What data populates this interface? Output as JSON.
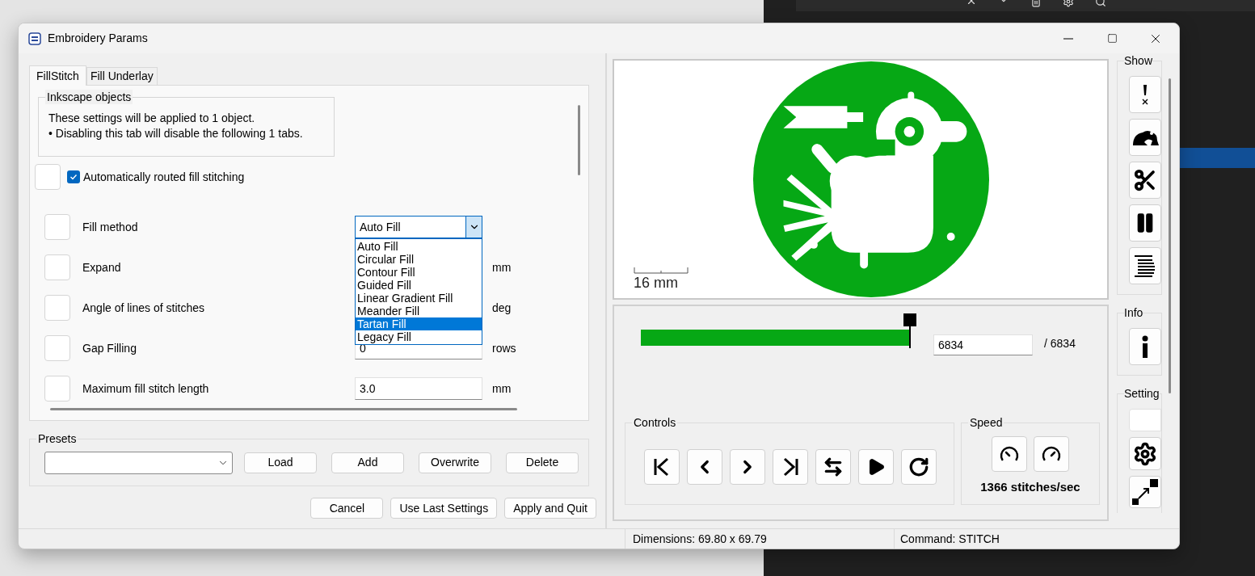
{
  "window": {
    "title": "Embroidery Params"
  },
  "tabs": [
    {
      "label": "FillStitch",
      "selected": true
    },
    {
      "label": "Fill Underlay",
      "selected": false
    }
  ],
  "inkscape_objects": {
    "title": "Inkscape objects",
    "lines": [
      "These settings will be applied to 1 object.",
      "• Disabling this tab will disable the following 1 tabs."
    ]
  },
  "auto_routed": {
    "label": "Automatically routed fill stitching",
    "checked": true
  },
  "params": [
    {
      "label": "Fill method",
      "kind": "dropdown",
      "value": "Auto Fill"
    },
    {
      "label": "Expand",
      "kind": "number",
      "unit": "mm"
    },
    {
      "label": "Angle of lines of stitches",
      "kind": "number",
      "unit": "deg"
    },
    {
      "label": "Gap Filling",
      "kind": "number",
      "value": "0",
      "unit": "rows"
    },
    {
      "label": "Maximum fill stitch length",
      "kind": "number",
      "value": "3.0",
      "unit": "mm"
    }
  ],
  "fill_method_menu": [
    {
      "label": "Auto Fill",
      "selected": false
    },
    {
      "label": "Circular Fill",
      "selected": false
    },
    {
      "label": "Contour Fill",
      "selected": false
    },
    {
      "label": "Guided Fill",
      "selected": false
    },
    {
      "label": "Linear Gradient Fill",
      "selected": false
    },
    {
      "label": "Meander Fill",
      "selected": false
    },
    {
      "label": "Tartan Fill",
      "selected": true
    },
    {
      "label": "Legacy Fill",
      "selected": false
    }
  ],
  "presets": {
    "title": "Presets",
    "buttons": [
      "Load",
      "Add",
      "Overwrite",
      "Delete"
    ]
  },
  "dialog_buttons": [
    "Cancel",
    "Use Last Settings",
    "Apply and Quit"
  ],
  "preview": {
    "scale_label": "16 mm"
  },
  "stitch_slider": {
    "level": 1,
    "value": "6834",
    "total": "/ 6834"
  },
  "controls": {
    "title": "Controls"
  },
  "speed": {
    "title": "Speed",
    "rate": "1366 stitches/sec"
  },
  "side_groups": [
    {
      "title": "Show"
    },
    {
      "title": "Info"
    },
    {
      "title": "Setting"
    }
  ],
  "status_bar": [
    "Dimensions: 69.80 x 69.79",
    "Command: STITCH"
  ]
}
